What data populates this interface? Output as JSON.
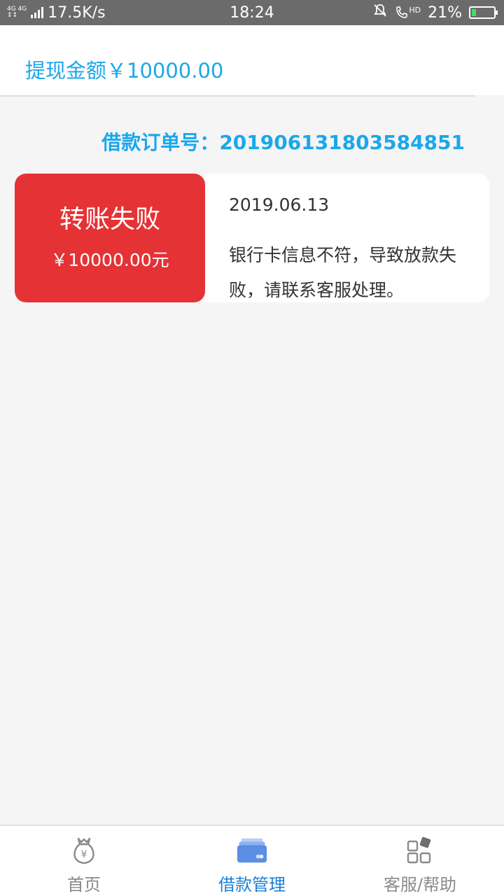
{
  "status_bar": {
    "network_type": "4G 4G",
    "speed": "17.5K/s",
    "time": "18:24",
    "hd_label": "HD",
    "battery": "21%",
    "battery_level": 0.21,
    "battery_color": "#3ddc6b"
  },
  "header": {
    "title": "提现金额￥10000.00"
  },
  "order": {
    "label": "借款订单号：",
    "number": "201906131803584851"
  },
  "record": {
    "status": "转账失败",
    "amount": "￥10000.00元",
    "date": "2019.06.13",
    "message": "银行卡信息不符，导致放款失败，请联系客服处理。",
    "status_color": "#e53235"
  },
  "bottom_nav": {
    "items": [
      {
        "label": "首页",
        "icon": "money-bag-icon",
        "active": false
      },
      {
        "label": "借款管理",
        "icon": "card-icon",
        "active": true
      },
      {
        "label": "客服/帮助",
        "icon": "grid-icon",
        "active": false
      }
    ]
  },
  "colors": {
    "accent": "#1aa7ec",
    "active_nav": "#1a7fd6",
    "background": "#f5f5f5"
  }
}
